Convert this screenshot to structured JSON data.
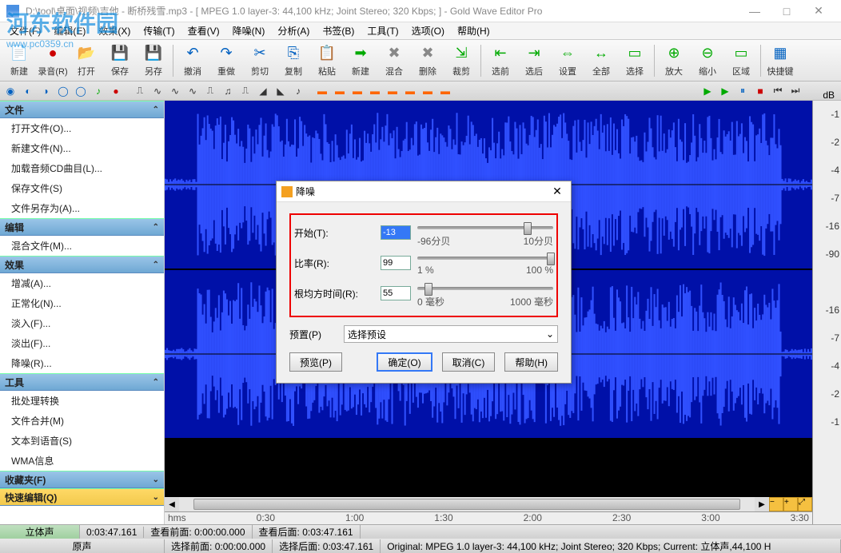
{
  "window": {
    "title": "D:\\tool\\桌面\\视频\\吉他 - 断桥残雪.mp3 - [ MPEG 1.0 layer-3: 44,100 kHz; Joint Stereo; 320 Kbps;  ] - Gold Wave Editor Pro"
  },
  "watermark": {
    "name": "河东软件园",
    "url": "www.pc0359.cn"
  },
  "menu": {
    "file": "文件(F)",
    "edit": "编辑(E)",
    "effects": "效果(X)",
    "transport": "传输(T)",
    "view": "查看(V)",
    "denoise": "降噪(N)",
    "analyze": "分析(A)",
    "bookmarks": "书签(B)",
    "tools": "工具(T)",
    "options": "选项(O)",
    "help": "帮助(H)"
  },
  "toolbar": {
    "new": "新建",
    "record": "录音(R)",
    "open": "打开",
    "save": "保存",
    "saveas": "另存",
    "undo": "撤消",
    "redo": "重做",
    "cut": "剪切",
    "copy": "复制",
    "paste": "粘贴",
    "new2": "新建",
    "mix": "混合",
    "delete": "删除",
    "crop": "裁剪",
    "selstart": "选前",
    "selend": "选后",
    "settings": "设置",
    "all": "全部",
    "select": "选择",
    "zoomin": "放大",
    "zoomout": "缩小",
    "region": "区域",
    "shortcuts": "快捷键"
  },
  "sidebar": {
    "file": {
      "header": "文件",
      "items": [
        "打开文件(O)...",
        "新建文件(N)...",
        "加载音频CD曲目(L)...",
        "保存文件(S)",
        "文件另存为(A)..."
      ]
    },
    "edit": {
      "header": "编辑",
      "items": [
        "混合文件(M)..."
      ]
    },
    "effects": {
      "header": "效果",
      "items": [
        "增减(A)...",
        "正常化(N)...",
        "淡入(F)...",
        "淡出(F)...",
        "降噪(R)..."
      ]
    },
    "tools": {
      "header": "工具",
      "items": [
        "批处理转换",
        "文件合并(M)",
        "文本到语音(S)",
        "WMA信息"
      ]
    },
    "favorites": {
      "header": "收藏夹(F)"
    },
    "quickedit": {
      "header": "快速编辑(Q)"
    }
  },
  "dialog": {
    "title": "降噪",
    "start_label": "开始(T):",
    "start_val": "-13",
    "start_min": "-96分贝",
    "start_max": "10分贝",
    "ratio_label": "比率(R):",
    "ratio_val": "99",
    "ratio_min": "1 %",
    "ratio_max": "100 %",
    "rms_label": "根均方时间(R):",
    "rms_val": "55",
    "rms_min": "0 毫秒",
    "rms_max": "1000 毫秒",
    "preset_label": "预置(P)",
    "preset_placeholder": "选择预设",
    "preview": "预览(P)",
    "ok": "确定(O)",
    "cancel": "取消(C)",
    "help": "帮助(H)"
  },
  "timeline": {
    "unit": "hms",
    "ticks": [
      "0:30",
      "1:00",
      "1:30",
      "2:00",
      "2:30",
      "3:00",
      "3:30"
    ]
  },
  "db_scale": {
    "header": "dB",
    "marks": [
      "-1",
      "-2",
      "-4",
      "-7",
      "-16",
      "-90",
      "-16",
      "-7",
      "-4",
      "-2",
      "-1"
    ]
  },
  "status1": {
    "channels": "立体声",
    "duration": "0:03:47.161",
    "before_label": "查看前面:",
    "before_val": "0:00:00.000",
    "after_label": "查看后面:",
    "after_val": "0:03:47.161"
  },
  "status2": {
    "original": "原声",
    "sel_before_label": "选择前面:",
    "sel_before_val": "0:00:00.000",
    "sel_after_label": "选择后面:",
    "sel_after_val": "0:03:47.161",
    "info": "Original:  MPEG 1.0 layer-3: 44,100 kHz; Joint Stereo; 320 Kbps;  Current:  立体声,44,100 H"
  }
}
